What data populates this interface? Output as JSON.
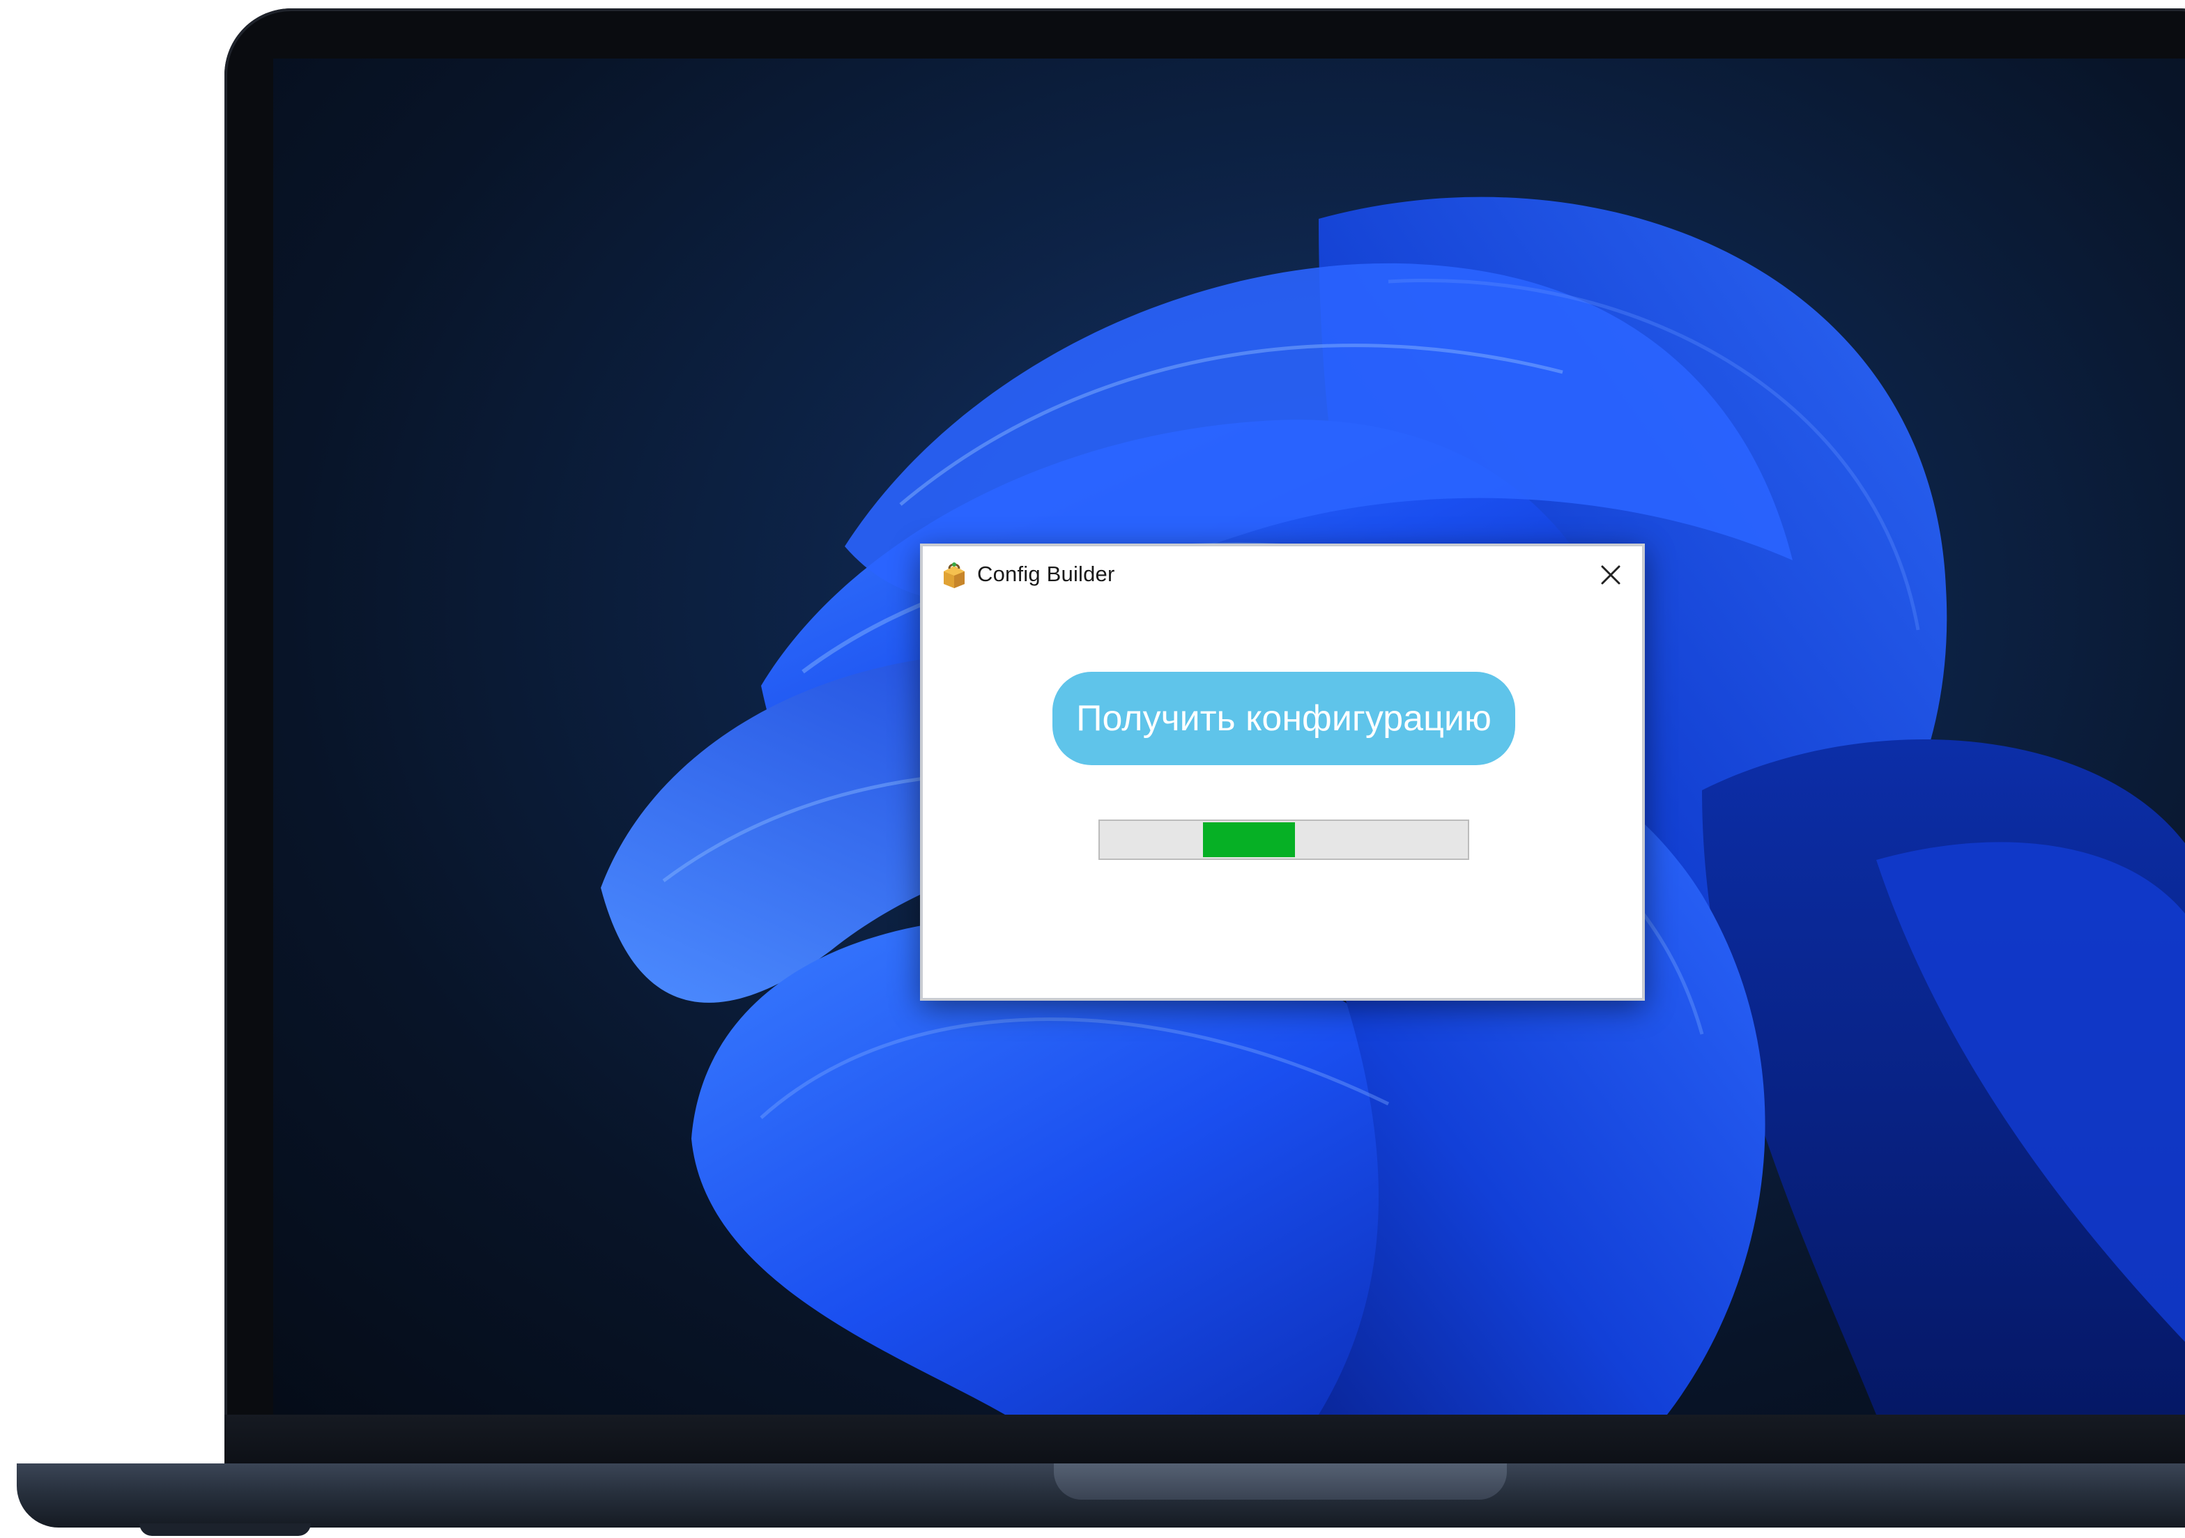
{
  "dialog": {
    "title": "Config Builder",
    "app_icon": "package-icon",
    "close_icon": "close-icon",
    "primary_button_label": "Получить конфигурацию",
    "progress": {
      "mode": "indeterminate-marquee",
      "segment_start_fraction": 0.28,
      "segment_length_fraction": 0.25,
      "fill_color": "#06b025",
      "track_color": "#e6e6e6"
    }
  },
  "colors": {
    "button_accent": "#5fc4ea",
    "wallpaper_accent": "#1c4ff0"
  }
}
